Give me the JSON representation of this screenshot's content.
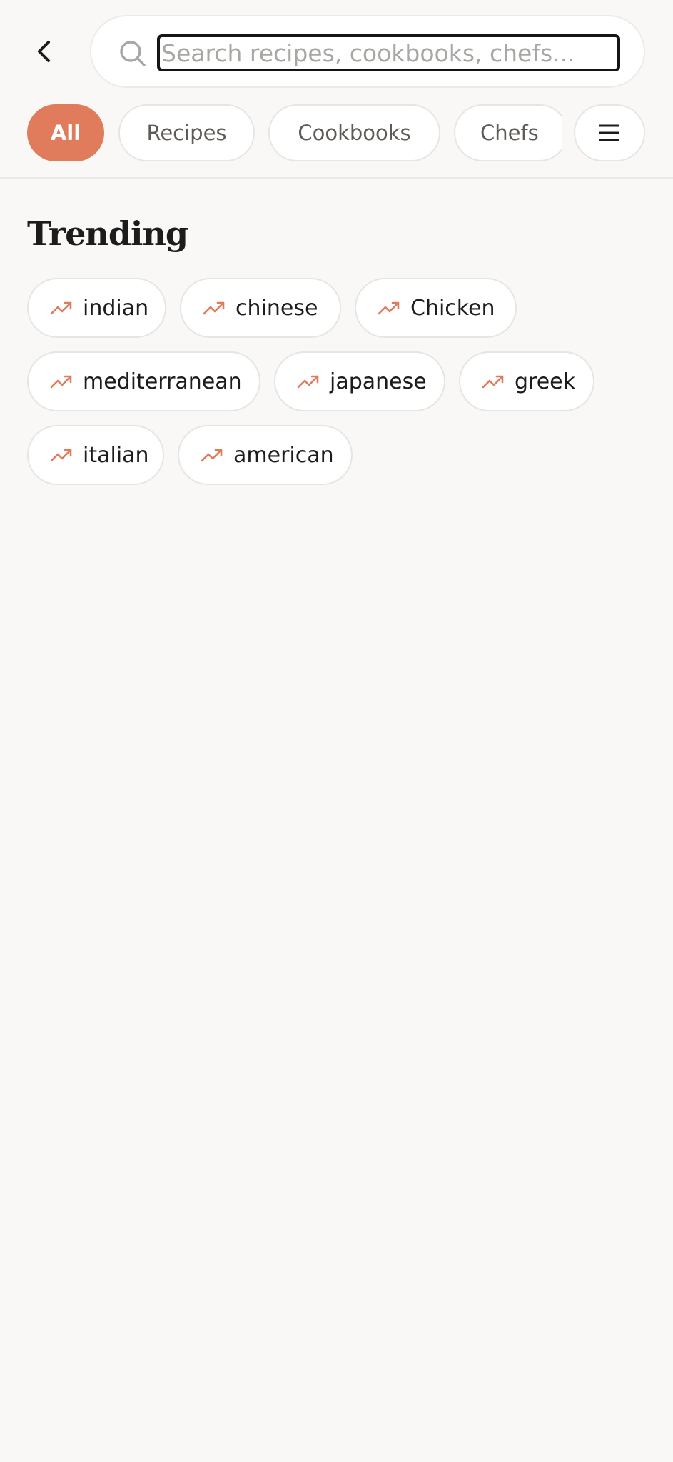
{
  "search": {
    "placeholder": "Search recipes, cookbooks, chefs...",
    "value": ""
  },
  "filters": {
    "tabs": [
      {
        "label": "All",
        "active": true
      },
      {
        "label": "Recipes",
        "active": false
      },
      {
        "label": "Cookbooks",
        "active": false
      },
      {
        "label": "Chefs",
        "active": false
      }
    ],
    "menu_icon": "menu-icon"
  },
  "trending": {
    "title": "Trending",
    "icon": "trending-up-icon",
    "items": [
      {
        "label": "indian"
      },
      {
        "label": "chinese"
      },
      {
        "label": "Chicken"
      },
      {
        "label": "mediterranean"
      },
      {
        "label": "japanese"
      },
      {
        "label": "greek"
      },
      {
        "label": "italian"
      },
      {
        "label": "american"
      }
    ]
  },
  "colors": {
    "accent": "#e07b5b",
    "background": "#f9f8f6",
    "chip_border": "#e7e5e2",
    "text": "#1c1c1c"
  }
}
